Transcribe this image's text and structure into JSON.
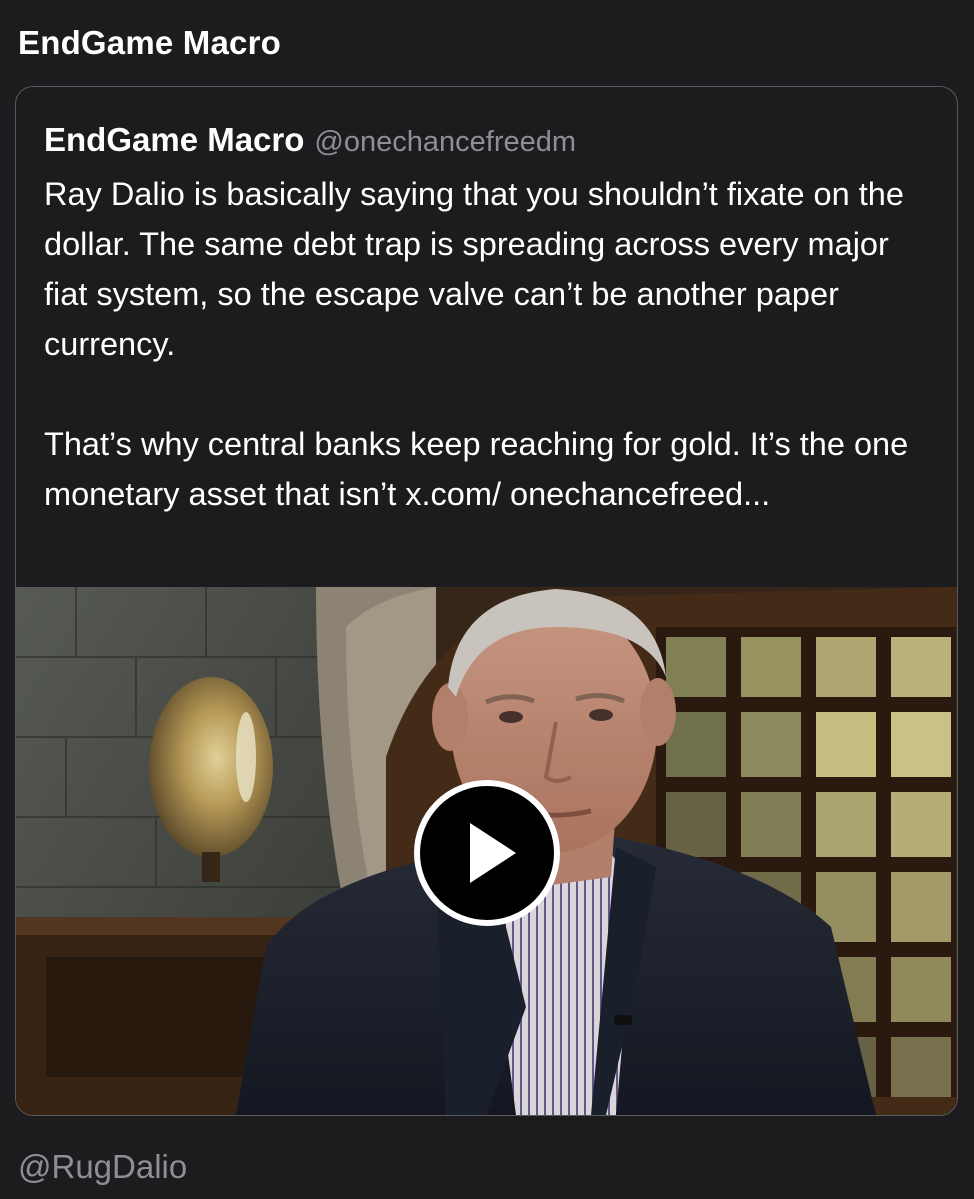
{
  "post": {
    "author_name": "EndGame Macro"
  },
  "quoted_post": {
    "author_name": "EndGame Macro",
    "author_handle": "@onechancefreedm",
    "paragraphs": [
      "Ray Dalio is basically saying that you shouldn’t fixate on the dollar. The same debt trap is spreading across every major fiat system, so the escape valve can’t be another paper currency.",
      "That’s why central banks keep reaching for gold. It’s the one monetary asset that isn’t x.com/ onechancefreed..."
    ],
    "media": {
      "type": "video",
      "icon": "play-icon"
    }
  },
  "footer": {
    "handle": "@RugDalio"
  },
  "colors": {
    "background": "#1c1c1e",
    "text": "#ffffff",
    "secondary_text": "#8e8e93",
    "card_border": "#5a5a5e"
  }
}
